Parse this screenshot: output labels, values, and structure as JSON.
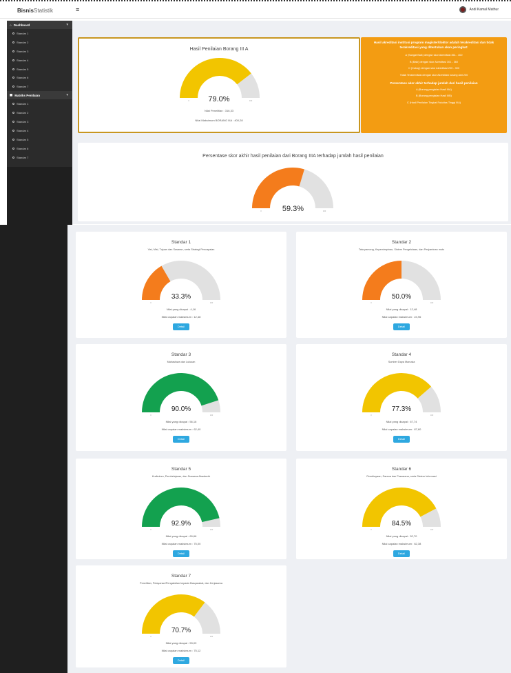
{
  "header": {
    "brand": "Bisnis",
    "brand_suffix": "Statistik",
    "user_name": "Andi Kamal Mathur"
  },
  "sidebar": {
    "sections": [
      {
        "title": "Dashboard",
        "items": [
          "Standar 1",
          "Standar 2",
          "Standar 3",
          "Standar 4",
          "Standar 5",
          "Standar 6",
          "Standar 7"
        ]
      },
      {
        "title": "Matriks Penilaian",
        "items": [
          "Standar 1",
          "Standar 2",
          "Standar 3",
          "Standar 4",
          "Standar 5",
          "Standar 6",
          "Standar 7"
        ]
      }
    ]
  },
  "summary": {
    "title": "Hasil Penilaian Borang III A",
    "percent": 79.0,
    "value_text": "79.0%",
    "line1": "Nilai Penelitian : 316,33",
    "line2": "Nilai Maksimum BORANG IIIA : 400,28",
    "color": "#f2c500"
  },
  "orange_panel": {
    "heading": "Hasil akreditasi institusi program magister/doktor adalah terakreditasi dan tidak terakreditasi yang ditentukan akan peringkat:",
    "lines": [
      "A (Sangat Baik) dengan skor Akreditasi 361 - 400",
      "B (Baik) dengan skor Akreditasi 301 - 360",
      "C (Cukup) dengan skor Akreditasi 200 - 300",
      "Tidak Terakreditasi dengan skor Akreditasi kurang dari 200"
    ],
    "heading2": "Persentase akor akhir terhadap jumlah dari hasil penilaian",
    "lines2": [
      "A (Borang pengisian Hasil IIIA)",
      "B (Borang pengisian Hasil IIIB)",
      "C (Hasil Penilaian Tingkat Fakultas Tinggi IIIA)"
    ],
    "color": "#f39c12"
  },
  "percentage": {
    "title": "Persentase skor akhir hasil penilaian dari Borang IIIA terhadap jumlah hasil penilaian",
    "percent": 59.3,
    "value_text": "59.3%",
    "color": "#f47c1c"
  },
  "standards": [
    {
      "title": "Standar 1",
      "subtitle": "Visi, Misi, Tujuan dan Sasaran, serta Strategi Pencapaian",
      "percent": 33.3,
      "value_text": "33.3%",
      "line1": "Nilai yang dicapai : 4,16",
      "line2": "Nilai capaian maksimum : 12,48",
      "button": "Detail",
      "color": "#f47c1c"
    },
    {
      "title": "Standar 2",
      "subtitle": "Tata pamong, Kepemimpinan, Sistem Pengelolaan, dan Penjaminan mutu",
      "percent": 50.0,
      "value_text": "50.0%",
      "line1": "Nilai yang dicapai : 12,48",
      "line2": "Nilai capaian maksimum : 24,96",
      "button": "Detail",
      "color": "#f47c1c"
    },
    {
      "title": "Standar 3",
      "subtitle": "Mahasiswa dan Lulusan",
      "percent": 90.0,
      "value_text": "90.0%",
      "line1": "Nilai yang dicapai : 56,16",
      "line2": "Nilai capaian maksimum : 62,40",
      "button": "Detail",
      "color": "#13a14f"
    },
    {
      "title": "Standar 4",
      "subtitle": "Sumber Daya Manusia",
      "percent": 77.3,
      "value_text": "77.3%",
      "line1": "Nilai yang dicapai : 67,74",
      "line2": "Nilai capaian maksimum : 87,60",
      "button": "Detail",
      "color": "#f2c500"
    },
    {
      "title": "Standar 5",
      "subtitle": "Kurikulum, Pembelajaran, dan Suasana Akademik",
      "percent": 92.9,
      "value_text": "92.9%",
      "line1": "Nilai yang dicapai : 69,66",
      "line2": "Nilai capaian maksimum : 75,00",
      "button": "Detail",
      "color": "#13a14f"
    },
    {
      "title": "Standar 6",
      "subtitle": "Pembiayaan, Sarana dan Prasarana, serta Sistem Informasi",
      "percent": 84.5,
      "value_text": "84.5%",
      "line1": "Nilai yang dicapai : 52,70",
      "line2": "Nilai capaian maksimum : 62,38",
      "button": "Detail",
      "color": "#f2c500"
    },
    {
      "title": "Standar 7",
      "subtitle": "Penelitian, Pelayanan/Pengabdian kepada Masyarakat, dan Kerjasama",
      "percent": 70.7,
      "value_text": "70.7%",
      "line1": "Nilai yang dicapai : 53,09",
      "line2": "Nilai capaian maksimum : 75,12",
      "button": "Detail",
      "color": "#f2c500"
    }
  ]
}
